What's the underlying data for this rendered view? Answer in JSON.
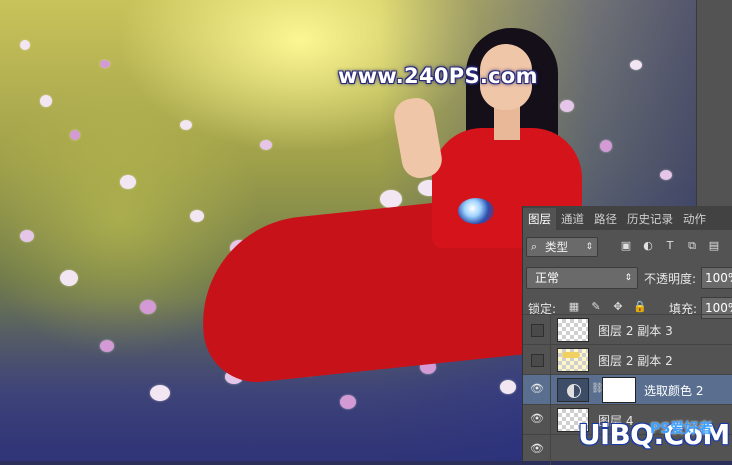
{
  "watermarks": {
    "top": "www.240PS.com",
    "bottom_main": "UiBQ.CoM",
    "bottom_sub": "PS爱好者"
  },
  "panel": {
    "tabs": [
      {
        "label": "图层",
        "active": true
      },
      {
        "label": "通道",
        "active": false
      },
      {
        "label": "路径",
        "active": false
      },
      {
        "label": "历史记录",
        "active": false
      },
      {
        "label": "动作",
        "active": false
      }
    ],
    "kind_filter": {
      "label": "类型"
    },
    "filter_icons": [
      "image-filter-icon",
      "adjustment-filter-icon",
      "type-filter-icon",
      "shape-filter-icon",
      "smart-object-filter-icon"
    ],
    "blend_mode": "正常",
    "opacity_label": "不透明度:",
    "opacity_value": "100%",
    "lock_label": "锁定:",
    "lock_icons": [
      "lock-transparent-icon",
      "lock-paint-icon",
      "lock-move-icon",
      "lock-all-icon"
    ],
    "fill_label": "填充:",
    "fill_value": "100%",
    "layers": [
      {
        "name": "图层 2 副本 3",
        "visible": false,
        "selected": false,
        "thumb": "transparent"
      },
      {
        "name": "图层 2 副本 2",
        "visible": false,
        "selected": false,
        "thumb": "yellow"
      },
      {
        "name": "选取颜色 2",
        "visible": true,
        "selected": true,
        "thumb": "adjustment"
      },
      {
        "name": "图层 4",
        "visible": true,
        "selected": false,
        "thumb": "transparent"
      }
    ]
  }
}
